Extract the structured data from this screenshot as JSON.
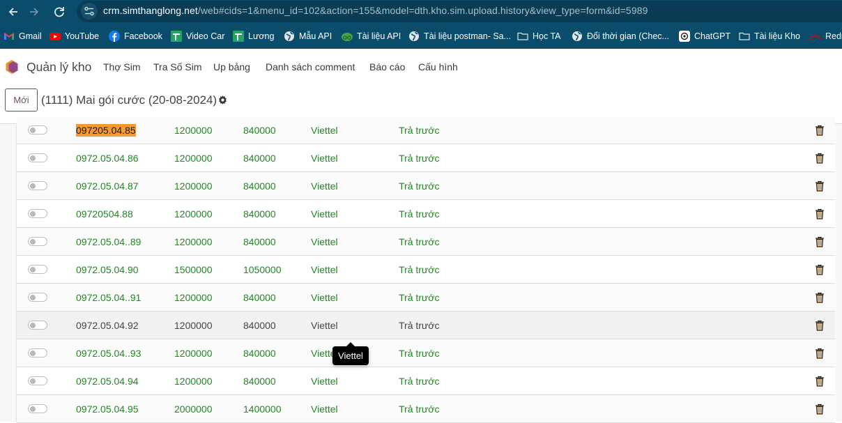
{
  "browser": {
    "url_host": "crm.simthanglong.net",
    "url_rest": "/web#cids=1&menu_id=102&action=155&model=dth.kho.sim.upload.history&view_type=form&id=5989",
    "bookmarks": [
      {
        "label": "Gmail",
        "icon": "gmail-icon"
      },
      {
        "label": "YouTube",
        "icon": "youtube-icon"
      },
      {
        "label": "Facebook",
        "icon": "facebook-icon"
      },
      {
        "label": "Video Car",
        "icon": "sheets-icon"
      },
      {
        "label": "Lương",
        "icon": "sheets-icon"
      },
      {
        "label": "Mẫu API",
        "icon": "globe-icon"
      },
      {
        "label": "Tài liệu API",
        "icon": "swagger-icon"
      },
      {
        "label": "Tài liệu postman- Sa...",
        "icon": "globe-icon"
      },
      {
        "label": "Học TA",
        "icon": "folder-icon"
      },
      {
        "label": "Đổi thời gian (Chec...",
        "icon": "globe-icon"
      },
      {
        "label": "ChatGPT",
        "icon": "chatgpt-icon"
      },
      {
        "label": "Tài liệu Kho",
        "icon": "folder-icon"
      },
      {
        "label": "Redm",
        "icon": "redmine-icon"
      }
    ]
  },
  "app": {
    "name": "Quản lý kho",
    "menu": [
      "Thợ Sim",
      "Tra Số Sim",
      "Up bảng",
      "Danh sách comment",
      "Báo cáo",
      "Cấu hình"
    ]
  },
  "control_panel": {
    "new_label": "Mới",
    "breadcrumb": "(1111) Mai gói cước (20-08-2024)"
  },
  "rows": [
    {
      "number": "097205.04.85",
      "price": "1200000",
      "cost": "840000",
      "carrier": "Viettel",
      "type": "Trả trước",
      "highlighted": true
    },
    {
      "number": "0972.05.04.86",
      "price": "1200000",
      "cost": "840000",
      "carrier": "Viettel",
      "type": "Trả trước"
    },
    {
      "number": "0972.05.04.87",
      "price": "1200000",
      "cost": "840000",
      "carrier": "Viettel",
      "type": "Trả trước"
    },
    {
      "number": "09720504.88",
      "price": "1200000",
      "cost": "840000",
      "carrier": "Viettel",
      "type": "Trả trước"
    },
    {
      "number": "0972.05.04..89",
      "price": "1200000",
      "cost": "840000",
      "carrier": "Viettel",
      "type": "Trả trước"
    },
    {
      "number": "0972.05.04.90",
      "price": "1500000",
      "cost": "1050000",
      "carrier": "Viettel",
      "type": "Trả trước"
    },
    {
      "number": "0972.05.04..91",
      "price": "1200000",
      "cost": "840000",
      "carrier": "Viettel",
      "type": "Trả trước"
    },
    {
      "number": "0972.05.04.92",
      "price": "1200000",
      "cost": "840000",
      "carrier": "Viettel",
      "type": "Trả trước",
      "hovered": true
    },
    {
      "number": "0972.05.04..93",
      "price": "1200000",
      "cost": "840000",
      "carrier": "Viettel",
      "type": "Trả trước"
    },
    {
      "number": "0972.05.04.94",
      "price": "1200000",
      "cost": "840000",
      "carrier": "Viettel",
      "type": "Trả trước"
    },
    {
      "number": "0972.05.04.95",
      "price": "2000000",
      "cost": "1400000",
      "carrier": "Viettel",
      "type": "Trả trước"
    }
  ],
  "tooltip": {
    "text": "Viettel"
  },
  "colors": {
    "browser_bg": "#0b4c6a",
    "brand": "#714b67",
    "row_text": "#1f8a22",
    "highlight": "#f59932"
  }
}
